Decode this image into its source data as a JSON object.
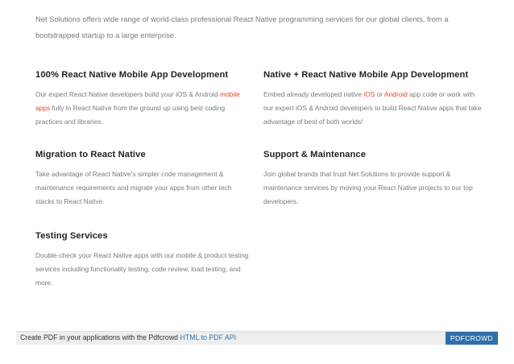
{
  "intro": "Net Solutions offers wide range of world-class professional React Native programming services for our global clients, from a bootstrapped startup to a large enterprise.",
  "services": [
    {
      "title": "100% React Native Mobile App Development",
      "text_a": "Our expert React Native developers build your iOS & Android ",
      "link_1": "mobile apps",
      "text_b": " fully in React Native from the ground up using best coding practices and libraries."
    },
    {
      "title": "Native + React Native Mobile App Development",
      "text_a": "Embed already developed native ",
      "link_1": "iOS",
      "text_b": " or ",
      "link_2": "Android",
      "text_c": " app code or work with our expert iOS & Android developers to build React Native apps that take advantage of best of both worlds!"
    },
    {
      "title": "Migration to React Native",
      "text": "Take advantage of React Native's simpler code management & maintenance requirements and migrate your apps from other tech stacks to React Native."
    },
    {
      "title": "Support & Maintenance",
      "text": "Join global brands that trust Net Solutions to provide support & maintenance services by moving your React Native projects to our top developers."
    },
    {
      "title": "Testing Services",
      "text": "Double-check your React Native apps with our mobile & product testing services including functionality testing, code review, load testing, and more."
    }
  ],
  "footer": {
    "text": "Create PDF in your applications with the Pdfcrowd ",
    "link": "HTML to PDF API",
    "brand": "PDFCROWD"
  },
  "colors": {
    "link": "#e0492f",
    "footer_link": "#2d76b6",
    "footer_brand_bg": "#2f6faa"
  }
}
